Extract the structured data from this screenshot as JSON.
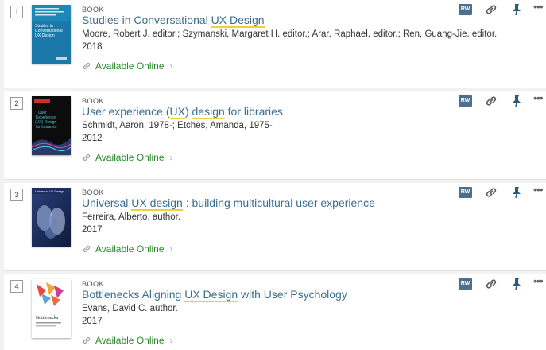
{
  "colors": {
    "title_link": "#3b6e8f",
    "highlight": "#f0cf3c",
    "available": "#2b8a2b",
    "rw_badge": "#4d6e8d"
  },
  "results": [
    {
      "number": "1",
      "type": "BOOK",
      "title_before": "Studies in Conversational ",
      "title_highlight": "UX Design",
      "title_after": "",
      "authors": "Moore, Robert J. editor.; Szymanski, Margaret H. editor.; Arar, Raphael. editor.; Ren, Guang-Jie. editor.",
      "year": "2018",
      "availability": "Available Online",
      "cover_text": "Studies in Conversational UX Design"
    },
    {
      "number": "2",
      "type": "BOOK",
      "title_before": "User experience (",
      "title_highlight": "UX",
      "title_middle": ") ",
      "title_highlight2": "design",
      "title_after": " for libraries",
      "authors": "Schmidt, Aaron, 1978-; Etches, Amanda, 1975-",
      "year": "2012",
      "availability": "Available Online",
      "cover_text": "User Experience (UX) Design for Libraries"
    },
    {
      "number": "3",
      "type": "BOOK",
      "title_before": "Universal ",
      "title_highlight": "UX design",
      "title_after": " : building multicultural user experience",
      "authors": "Ferreira, Alberto, author.",
      "year": "2017",
      "availability": "Available Online",
      "cover_text": "Universal UX Design"
    },
    {
      "number": "4",
      "type": "BOOK",
      "title_before": "Bottlenecks Aligning ",
      "title_highlight": "UX Design",
      "title_after": " with User Psychology",
      "authors": "Evans, David C. author.",
      "year": "2017",
      "availability": "Available Online",
      "cover_text": "Bottlenecks"
    }
  ],
  "actions": {
    "rw_label": "RW",
    "more_label": "•••",
    "chevron": "›",
    "icons": [
      "refworks-icon",
      "permalink-icon",
      "pin-icon",
      "more-options-icon"
    ]
  }
}
